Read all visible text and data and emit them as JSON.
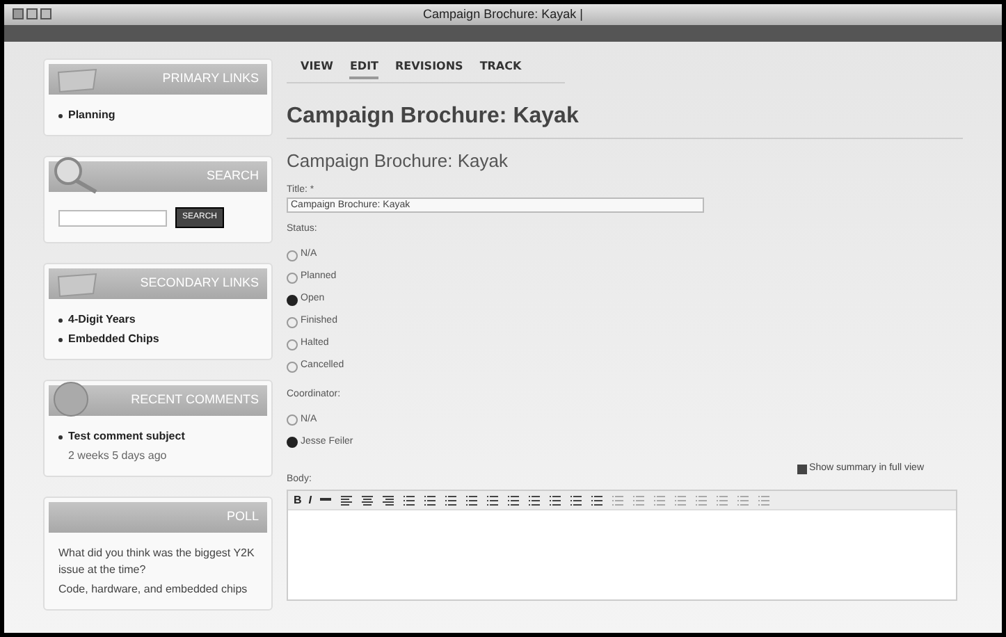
{
  "window": {
    "title": "Campaign Brochure: Kayak |"
  },
  "sidebar": {
    "blocks": [
      {
        "kind": "links",
        "title": "PRIMARY LINKS",
        "items": [
          "Planning"
        ]
      },
      {
        "kind": "search",
        "title": "SEARCH",
        "button": "SEARCH"
      },
      {
        "kind": "links",
        "title": "SECONDARY LINKS",
        "items": [
          "4-Digit Years",
          "Embedded Chips"
        ]
      },
      {
        "kind": "comments",
        "title": "RECENT COMMENTS",
        "items": [
          {
            "subject": "Test comment subject",
            "age": "2 weeks 5 days ago"
          }
        ]
      },
      {
        "kind": "poll",
        "title": "POLL",
        "question": "What did you think was the biggest Y2K issue at the time?",
        "choice": "Code, hardware, and embedded chips"
      }
    ]
  },
  "tabs": [
    {
      "label": "VIEW",
      "selected": false
    },
    {
      "label": "EDIT",
      "selected": true
    },
    {
      "label": "REVISIONS",
      "selected": false
    },
    {
      "label": "TRACK",
      "selected": false
    }
  ],
  "page_title": "Campaign Brochure: Kayak",
  "form_title": "Campaign Brochure: Kayak",
  "title_field": {
    "label": "Title: *",
    "value": "Campaign Brochure: Kayak"
  },
  "status": {
    "label": "Status:",
    "options": [
      {
        "label": "N/A",
        "selected": false
      },
      {
        "label": "Planned",
        "selected": false
      },
      {
        "label": "Open",
        "selected": true
      },
      {
        "label": "Finished",
        "selected": false
      },
      {
        "label": "Halted",
        "selected": false
      },
      {
        "label": "Cancelled",
        "selected": false
      }
    ]
  },
  "coordinator": {
    "label": "Coordinator:",
    "options": [
      {
        "label": "N/A",
        "selected": false
      },
      {
        "label": "Jesse Feiler",
        "selected": true
      }
    ]
  },
  "body": {
    "label": "Body:",
    "show_summary": {
      "label": "Show summary in full view",
      "checked": true
    },
    "toolbar": [
      "B",
      "I"
    ]
  }
}
